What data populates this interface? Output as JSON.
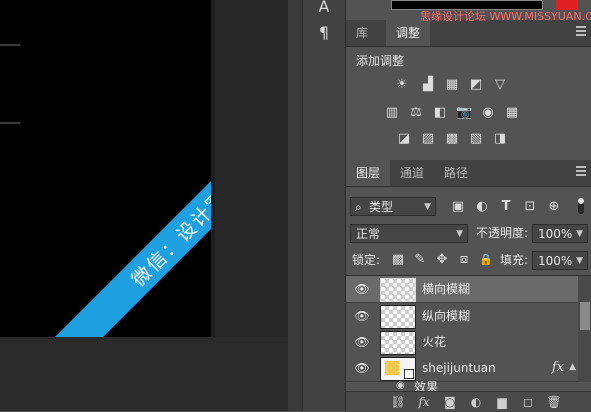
{
  "canvas": {
    "banner_text": "微信：设计军团"
  },
  "tool_strip": {
    "character_icon": "A",
    "paragraph_icon": "¶"
  },
  "watermark": {
    "text": "思缘设计论坛  WWW.MISSYUAN.COM"
  },
  "adjust_panel": {
    "tabs": [
      "库",
      "调整"
    ],
    "active_tab": "调整",
    "title": "添加调整",
    "row1_icons": [
      "☀",
      "▟",
      "▦",
      "◩",
      "▽"
    ],
    "row2_icons": [
      "▥",
      "⚖",
      "◧",
      "📷",
      "◉",
      "▦"
    ],
    "row3_icons": [
      "◪",
      "▨",
      "▩",
      "▧",
      "◨"
    ]
  },
  "layers_panel": {
    "tabs": [
      "图层",
      "通道",
      "路径"
    ],
    "active_tab": "图层",
    "filter_value": "类型",
    "filter_icon": "⌕",
    "filter_buttons": [
      "▣",
      "◐",
      "T",
      "⊡",
      "⊕"
    ],
    "blend_mode": "正常",
    "opacity_label": "不透明度:",
    "opacity_value": "100%",
    "lock_label": "锁定:",
    "lock_icons": [
      "▩",
      "✎",
      "✥",
      "⧈",
      "🔒"
    ],
    "fill_label": "填充:",
    "fill_value": "100%",
    "layers": [
      {
        "name": "横向模糊",
        "selected": true,
        "fx": ""
      },
      {
        "name": "纵向模糊",
        "selected": false,
        "fx": ""
      },
      {
        "name": "火花",
        "selected": false,
        "fx": ""
      },
      {
        "name": "shejijuntuan",
        "selected": false,
        "fx": "fx"
      }
    ],
    "partial_row_label": "效果",
    "bottom_buttons": [
      "⛓",
      "fx",
      "◙",
      "◐",
      "▆",
      "◻",
      "🗑"
    ]
  },
  "colors": {
    "banner": "#1ea0e0",
    "panel_bg": "#535353",
    "canvas_bg": "#000000"
  }
}
